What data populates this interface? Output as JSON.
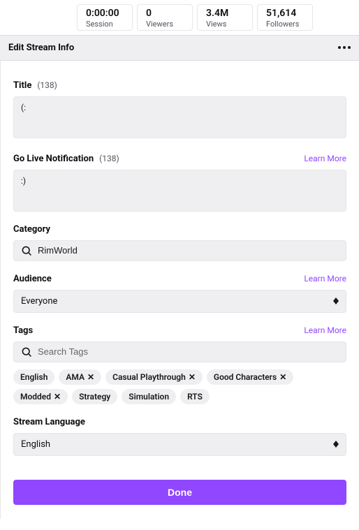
{
  "stats": {
    "session": {
      "value": "0:00:00",
      "label": "Session"
    },
    "viewers": {
      "value": "0",
      "label": "Viewers"
    },
    "views": {
      "value": "3.4M",
      "label": "Views"
    },
    "followers": {
      "value": "51,614",
      "label": "Followers"
    }
  },
  "panel_title": "Edit Stream Info",
  "title": {
    "label": "Title",
    "count": "(138)",
    "value": "(:"
  },
  "notification": {
    "label": "Go Live Notification",
    "count": "(138)",
    "learn_more": "Learn More",
    "value": ":)"
  },
  "category": {
    "label": "Category",
    "value": "RimWorld"
  },
  "audience": {
    "label": "Audience",
    "learn_more": "Learn More",
    "value": "Everyone"
  },
  "tags": {
    "label": "Tags",
    "learn_more": "Learn More",
    "search_placeholder": "Search Tags",
    "items": [
      {
        "label": "English",
        "removable": false
      },
      {
        "label": "AMA",
        "removable": true
      },
      {
        "label": "Casual Playthrough",
        "removable": true
      },
      {
        "label": "Good Characters",
        "removable": true
      },
      {
        "label": "Modded",
        "removable": true
      },
      {
        "label": "Strategy",
        "removable": false
      },
      {
        "label": "Simulation",
        "removable": false
      },
      {
        "label": "RTS",
        "removable": false
      }
    ]
  },
  "language": {
    "label": "Stream Language",
    "value": "English"
  },
  "done_label": "Done"
}
